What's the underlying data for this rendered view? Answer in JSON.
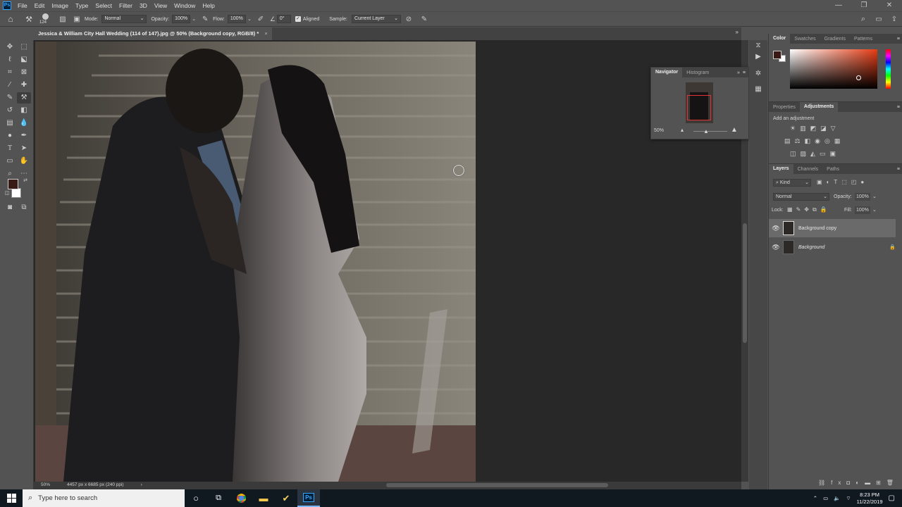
{
  "app": {
    "logo_text": "Ps"
  },
  "menu": [
    "File",
    "Edit",
    "Image",
    "Type",
    "Select",
    "Filter",
    "3D",
    "View",
    "Window",
    "Help"
  ],
  "options": {
    "brush_size": "124",
    "mode_label": "Mode:",
    "mode_value": "Normal",
    "opacity_label": "Opacity:",
    "opacity_value": "100%",
    "flow_label": "Flow:",
    "flow_value": "100%",
    "angle_value": "0°",
    "aligned_label": "Aligned",
    "sample_label": "Sample:",
    "sample_value": "Current Layer"
  },
  "document": {
    "tab_title": "Jessica & William City Hall Wedding (114 of 147).jpg @ 50% (Background copy, RGB/8) *",
    "close": "×"
  },
  "status": {
    "zoom": "50%",
    "doc_info": "4457 px x 6685 px (240 ppi)",
    "arrow": "›"
  },
  "navigator": {
    "tabs": [
      "Navigator",
      "Histogram"
    ],
    "zoom": "50%"
  },
  "color_panel": {
    "tabs": [
      "Color",
      "Swatches",
      "Gradients",
      "Patterns"
    ],
    "foreground": "#3a1a14",
    "background": "#ffffff"
  },
  "adjustments_panel": {
    "tabs": [
      "Properties",
      "Adjustments"
    ],
    "hint": "Add an adjustment"
  },
  "layers_panel": {
    "tabs": [
      "Layers",
      "Channels",
      "Paths"
    ],
    "filter_kind": "Kind",
    "blend_mode": "Normal",
    "opacity_label": "Opacity:",
    "opacity_value": "100%",
    "lock_label": "Lock:",
    "fill_label": "Fill:",
    "fill_value": "100%",
    "layers": [
      {
        "name": "Background copy",
        "selected": true
      },
      {
        "name": "Background",
        "selected": false,
        "locked": true
      }
    ]
  },
  "taskbar": {
    "search_placeholder": "Type here to search",
    "time": "8:23 PM",
    "date": "11/22/2019"
  }
}
